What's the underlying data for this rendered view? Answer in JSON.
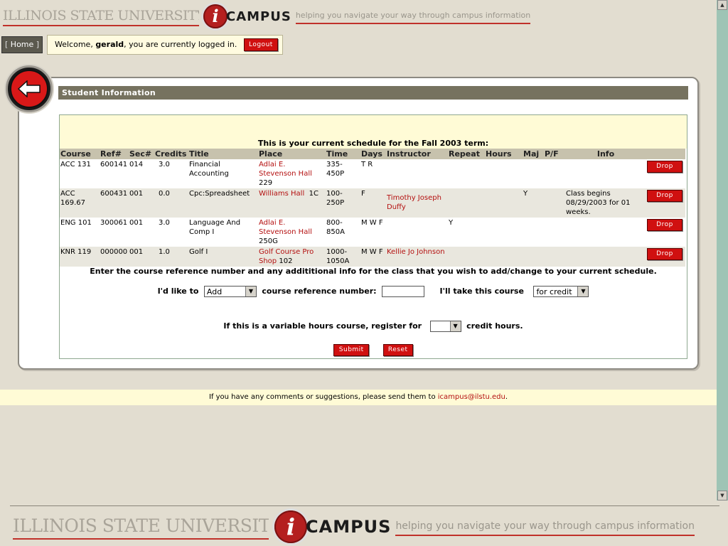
{
  "header": {
    "isu_wordmark": "ILLINOIS STATE UNIVERSITY",
    "logo_letter": "i",
    "logo_campus": "CAMPUS",
    "tagline": "helping you navigate your way through campus information"
  },
  "nav": {
    "home_label": "Home",
    "welcome_prefix": "Welcome, ",
    "username": "gerald",
    "welcome_suffix": ", you are currently logged in.",
    "logout_label": "Logout"
  },
  "section": {
    "title": "Student Information",
    "schedule_title": "This is your current schedule for the Fall 2003 term:"
  },
  "table": {
    "headers": [
      "Course",
      "Ref#",
      "Sec#",
      "Credits",
      "Title",
      "Place",
      "Time",
      "Days",
      "Instructor",
      "Repeat",
      "Hours",
      "Maj",
      "P/F",
      "Info",
      ""
    ],
    "rows": [
      {
        "course": "ACC 131",
        "ref": "600141",
        "sec": "014",
        "credits": "3.0",
        "title": "Financial Accounting",
        "place": "Adlai E. Stevenson Hall",
        "room": "229",
        "time": "335-450P",
        "days": "T R",
        "instructor": "",
        "repeat": "",
        "hours": "",
        "maj": "",
        "pf": "",
        "info": "",
        "action": "Drop"
      },
      {
        "course": "ACC 169.67",
        "ref": "600431",
        "sec": "001",
        "credits": "0.0",
        "title": "Cpc:Spreadsheet",
        "place": "Williams Hall",
        "room": "1C",
        "time": "100-250P",
        "days": "F",
        "instructor": "Timothy Joseph Duffy",
        "repeat": "",
        "hours": "",
        "maj": "Y",
        "pf": "",
        "info": "Class begins 08/29/2003 for 01 weeks.",
        "action": "Drop"
      },
      {
        "course": "ENG 101",
        "ref": "300061",
        "sec": "001",
        "credits": "3.0",
        "title": "Language And Comp I",
        "place": "Adlai E. Stevenson Hall",
        "room": "250G",
        "time": "800-850A",
        "days": "M W F",
        "instructor": "",
        "repeat": "Y",
        "hours": "",
        "maj": "",
        "pf": "",
        "info": "",
        "action": "Drop"
      },
      {
        "course": "KNR 119",
        "ref": "000000",
        "sec": "001",
        "credits": "1.0",
        "title": "Golf I",
        "place": "Golf Course Pro Shop",
        "room": "102",
        "time": "1000-1050A",
        "days": "M W F",
        "instructor": "Kellie Jo Johnson",
        "repeat": "",
        "hours": "",
        "maj": "",
        "pf": "",
        "info": "",
        "action": "Drop"
      }
    ]
  },
  "form": {
    "instructions": "Enter the course reference number and any addititional info for the class that you wish to add/change to your current schedule.",
    "like_to_label": "I'd like to",
    "action_value": "Add",
    "ref_label": "course reference number:",
    "ref_value": "",
    "take_label": "I'll take this course",
    "credit_value": "for credit",
    "variable_label": "If this is a variable hours course, register for",
    "hours_value": "",
    "hours_suffix": "credit hours.",
    "submit_label": "Submit",
    "reset_label": "Reset"
  },
  "footer": {
    "prefix": "If you have any comments or suggestions, please send them to ",
    "email": "icampus@ilstu.edu",
    "suffix": "."
  },
  "colors": {
    "background": "#e2ddd0",
    "accent_red": "#d01010",
    "section_bar": "#76725f",
    "table_header": "#c7c2ad",
    "highlight_yellow": "#fffbd6",
    "scrollbar": "#9ec4b5"
  }
}
